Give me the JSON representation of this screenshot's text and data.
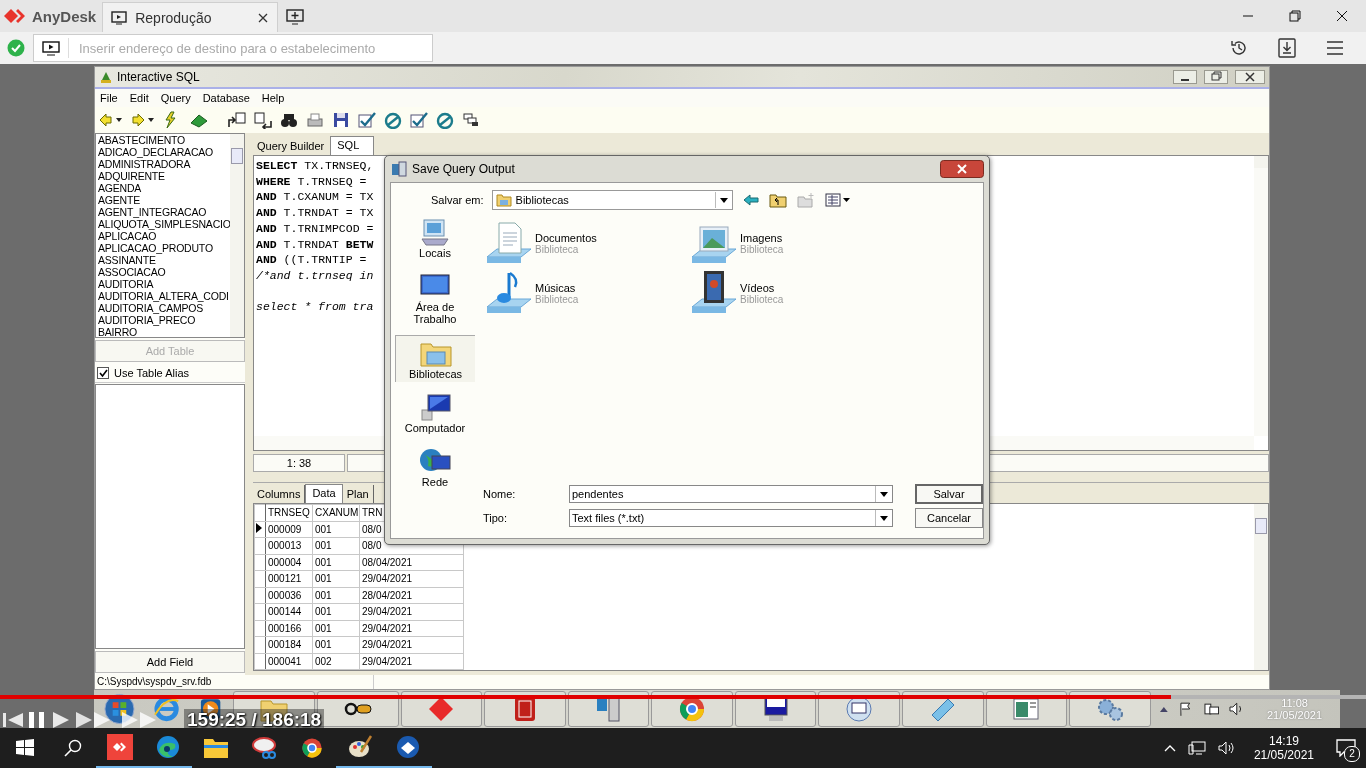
{
  "anydesk": {
    "logo": "AnyDesk",
    "tabs": [
      {
        "label": "Reprodução",
        "selected": true
      }
    ],
    "address_placeholder": "Inserir endereço de destino para o estabelecimento"
  },
  "sql_window": {
    "title": "Interactive SQL",
    "menu": [
      "File",
      "Edit",
      "Query",
      "Database",
      "Help"
    ],
    "tables": [
      "ABASTECIMENTO",
      "ADICAO_DECLARACAO",
      "ADMINISTRADORA",
      "ADQUIRENTE",
      "AGENDA",
      "AGENTE",
      "AGENT_INTEGRACAO",
      "ALIQUOTA_SIMPLESNACIO",
      "APLICACAO",
      "APLICACAO_PRODUTO",
      "ASSINANTE",
      "ASSOCIACAO",
      "AUDITORIA",
      "AUDITORIA_ALTERA_CODI",
      "AUDITORIA_CAMPOS",
      "AUDITORIA_PRECO",
      "BAIRRO"
    ],
    "add_table": "Add Table",
    "alias": {
      "label": "Use Table Alias",
      "checked": true
    },
    "add_field": "Add Field",
    "editor_tabs": [
      {
        "label": "Query Builder",
        "selected": false
      },
      {
        "label": "SQL",
        "selected": true
      }
    ],
    "sql_blocks": [
      [
        {
          "kind": "code",
          "text": "**SELECT** TX.TRNSEQ,"
        },
        {
          "kind": "code",
          "text": "**WHERE** T.TRNSEQ ="
        },
        {
          "kind": "code",
          "text": "**AND** T.CXANUM = TX"
        },
        {
          "kind": "code",
          "text": "**AND** T.TRNDAT = TX"
        },
        {
          "kind": "code",
          "text": "**AND** T.TRNIMPCOD ="
        },
        {
          "kind": "code",
          "text": "**AND** T.TRNDAT **BETW**"
        },
        {
          "kind": "code",
          "text": "**AND** ((T.TRNTIP ="
        },
        {
          "kind": "comment",
          "text": "/*and t.trnseq in"
        }
      ],
      [
        {
          "kind": "comment",
          "text": "select * from tra"
        }
      ]
    ],
    "cursor_position": "1: 38",
    "result_tabs": [
      {
        "label": "Columns",
        "selected": false
      },
      {
        "label": "Data",
        "selected": true
      },
      {
        "label": "Plan",
        "selected": false
      }
    ],
    "grid": {
      "columns": [
        "TRNSEQ",
        "CXANUM",
        "TRN"
      ],
      "rows": [
        {
          "cells": [
            "000009",
            "001",
            "08/0"
          ],
          "selected": true
        },
        {
          "cells": [
            "000013",
            "001",
            "08/0"
          ],
          "selected": false
        },
        {
          "cells": [
            "000004",
            "001",
            "08/04/2021"
          ],
          "selected": false
        },
        {
          "cells": [
            "000121",
            "001",
            "29/04/2021"
          ],
          "selected": false
        },
        {
          "cells": [
            "000036",
            "001",
            "28/04/2021"
          ],
          "selected": false
        },
        {
          "cells": [
            "000144",
            "001",
            "29/04/2021"
          ],
          "selected": false
        },
        {
          "cells": [
            "000166",
            "001",
            "29/04/2021"
          ],
          "selected": false
        },
        {
          "cells": [
            "000184",
            "001",
            "29/04/2021"
          ],
          "selected": false
        },
        {
          "cells": [
            "000041",
            "002",
            "29/04/2021"
          ],
          "selected": false
        }
      ]
    },
    "status": "C:\\Syspdv\\syspdv_srv.fdb"
  },
  "dialog": {
    "title": "Save Query Output",
    "save_in_label": "Salvar em:",
    "save_in_value": "Bibliotecas",
    "places": [
      {
        "label": "Locais",
        "kind": "recent",
        "selected": false
      },
      {
        "label": "Área de Trabalho",
        "kind": "desktop",
        "selected": false
      },
      {
        "label": "Bibliotecas",
        "kind": "libraries",
        "selected": true
      },
      {
        "label": "Computador",
        "kind": "computer",
        "selected": false
      },
      {
        "label": "Rede",
        "kind": "network",
        "selected": false
      }
    ],
    "items": [
      {
        "name": "Documentos",
        "type": "Biblioteca",
        "kind": "documents"
      },
      {
        "name": "Imagens",
        "type": "Biblioteca",
        "kind": "pictures"
      },
      {
        "name": "Músicas",
        "type": "Biblioteca",
        "kind": "music"
      },
      {
        "name": "Vídeos",
        "type": "Biblioteca",
        "kind": "videos"
      }
    ],
    "name_label": "Nome:",
    "name_value": "pendentes",
    "type_label": "Tipo:",
    "type_value": "Text files (*.txt)",
    "buttons": [
      "Salvar",
      "Cancelar"
    ]
  },
  "player": {
    "time": "159:25 / 186:18",
    "level": 0.857
  },
  "remote_clock": {
    "time": "11:08",
    "date": "21/05/2021"
  },
  "taskbar": {
    "time": "14:19",
    "date": "21/05/2021",
    "notifications": "2"
  }
}
